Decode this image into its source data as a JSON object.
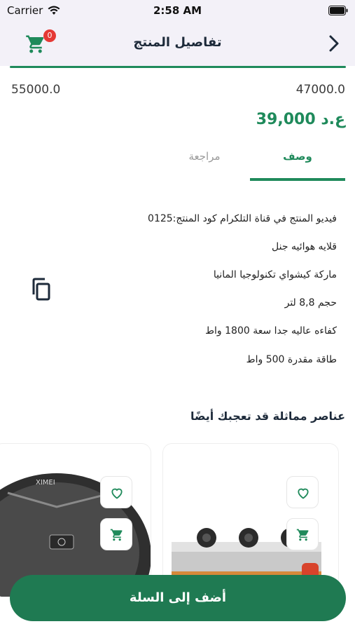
{
  "status_bar": {
    "carrier": "Carrier",
    "time": "2:58 AM"
  },
  "header": {
    "title": "تفاصيل المنتج",
    "cart_count": "0"
  },
  "prices": {
    "old_left": "55000.0",
    "old_right": "47000.0",
    "current": "39,000 ع.د"
  },
  "tabs": [
    {
      "label": "وصف",
      "active": true
    },
    {
      "label": "مراجعة",
      "active": false
    }
  ],
  "description": [
    "فيديو المنتج في قناة التلكرام كود المنتج:0125",
    "قلايه هوائيه جنل",
    "ماركة كيشواي تكنولوجيا المانيا",
    "حجم 8,8 لتر",
    "كفاءه عاليه جدا سعة 1800 واط",
    "طاقة مقدرة 500 واط"
  ],
  "similar": {
    "title": "عناصر مماثلة قد تعجبك أيضًا"
  },
  "products": [
    {
      "image_label": "gas-stove",
      "brand": ""
    },
    {
      "image_label": "robot-vacuum",
      "brand": "XIMEI"
    }
  ],
  "actions": {
    "add_to_cart": "أضف إلى السلة"
  },
  "colors": {
    "accent": "#1f8a5b",
    "button": "#1f7a52",
    "badge": "#e53935",
    "header_bg": "#f3f1f8"
  }
}
